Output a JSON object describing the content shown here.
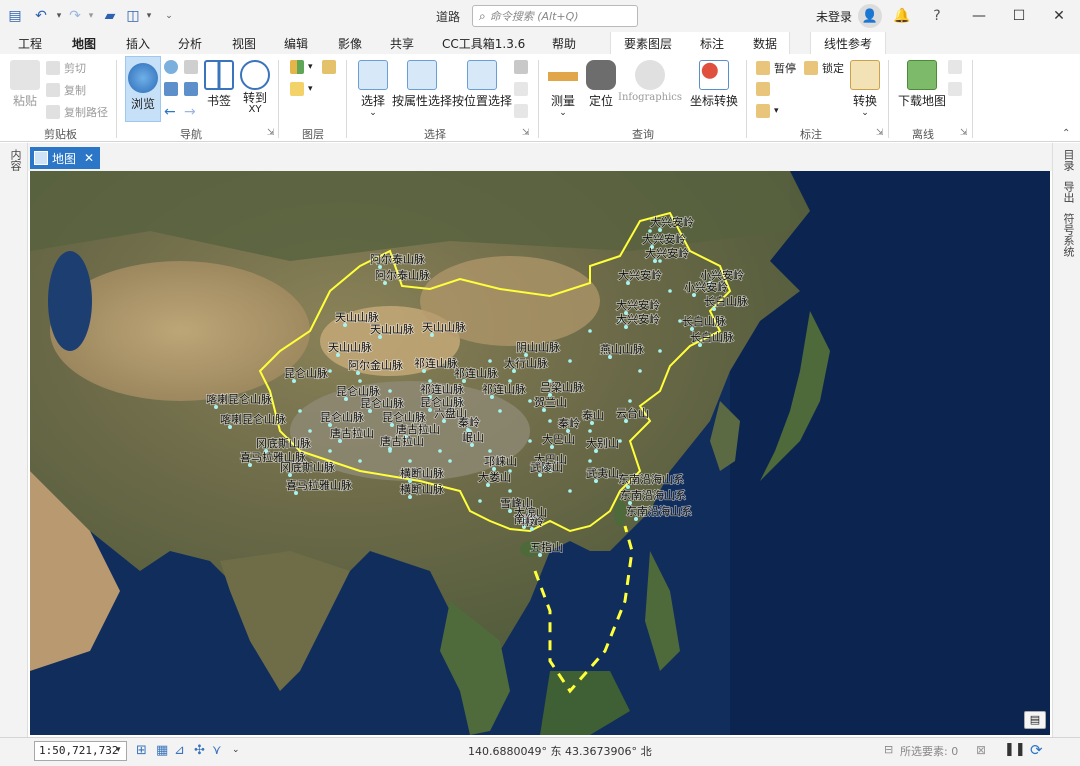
{
  "titlebar": {
    "document_title": "道路",
    "search_placeholder": "命令搜索 (Alt+Q)",
    "login_label": "未登录"
  },
  "tabs": [
    "工程",
    "地图",
    "插入",
    "分析",
    "视图",
    "编辑",
    "影像",
    "共享",
    "CC工具箱1.3.6",
    "帮助"
  ],
  "active_tab": "地图",
  "context_tabs": [
    "要素图层",
    "标注",
    "数据"
  ],
  "extra_tab": "线性参考",
  "ribbon": {
    "clipboard": {
      "paste": "粘贴",
      "cut": "剪切",
      "copy": "复制",
      "copy_path": "复制路径",
      "group": "剪贴板"
    },
    "navigate": {
      "explore": "浏览",
      "bookmarks": "书签",
      "goto_xy": "转到",
      "goto_xy_sub": "XY",
      "group": "导航"
    },
    "layer": {
      "group": "图层"
    },
    "selection": {
      "select": "选择",
      "by_attr": "按属性选择",
      "by_location": "按位置选择",
      "group": "选择"
    },
    "inquiry": {
      "measure": "测量",
      "locate": "定位",
      "infographics": "Infographics",
      "convert_coords": "坐标转换",
      "group": "查询"
    },
    "labeling": {
      "pause": "暂停",
      "lock": "锁定",
      "convert": "转换",
      "group": "标注"
    },
    "offline": {
      "download_map": "下载地图",
      "group": "离线"
    }
  },
  "left_panel": "内容",
  "right_panels": [
    "目录",
    "导出",
    "符号系统"
  ],
  "map_tab": {
    "label": "地图"
  },
  "map": {
    "colors": {
      "boundary": "#ffff3a",
      "ocean": "#102d5c",
      "points": "#a7f3f0"
    },
    "labels": [
      "阿尔泰山脉",
      "阿尔泰山脉",
      "大兴安岭",
      "大兴安岭",
      "大兴安岭",
      "大兴安岭",
      "小兴安岭",
      "小兴安岭",
      "大兴安岭",
      "大兴安岭",
      "长白山脉",
      "长白山脉",
      "长白山脉",
      "天山山脉",
      "天山山脉",
      "天山山脉",
      "天山山脉",
      "阴山山脉",
      "燕山山脉",
      "太行山脉",
      "阿尔金山脉",
      "祁连山脉",
      "祁连山脉",
      "祁连山脉",
      "祁连山脉",
      "贺兰山",
      "吕梁山脉",
      "昆仑山脉",
      "昆仑山脉",
      "昆仑山脉",
      "喀喇昆仑山脉",
      "喀喇昆仑山脉",
      "昆仑山脉",
      "昆仑山脉",
      "昆仑山脉",
      "唐古拉山",
      "唐古拉山",
      "唐古拉山",
      "冈底斯山脉",
      "喜马拉雅山脉",
      "冈底斯山脉",
      "喜马拉雅山脉",
      "六盘山",
      "秦岭",
      "秦岭",
      "泰山",
      "云台山",
      "大别山",
      "大巴山",
      "大巴山",
      "岷山",
      "大娄山",
      "邛崃山",
      "武陵山",
      "武夷山",
      "东南沿海山系",
      "东南沿海山系",
      "东南沿海山系",
      "雪峰山",
      "南岭",
      "南岭",
      "横断山脉",
      "横断山脉",
      "大凉山",
      "五指山"
    ]
  },
  "status": {
    "scale": "1:50,721,732",
    "coordinates": "140.6880049° 东  43.3673906° 北",
    "selected_features": "所选要素: 0"
  }
}
